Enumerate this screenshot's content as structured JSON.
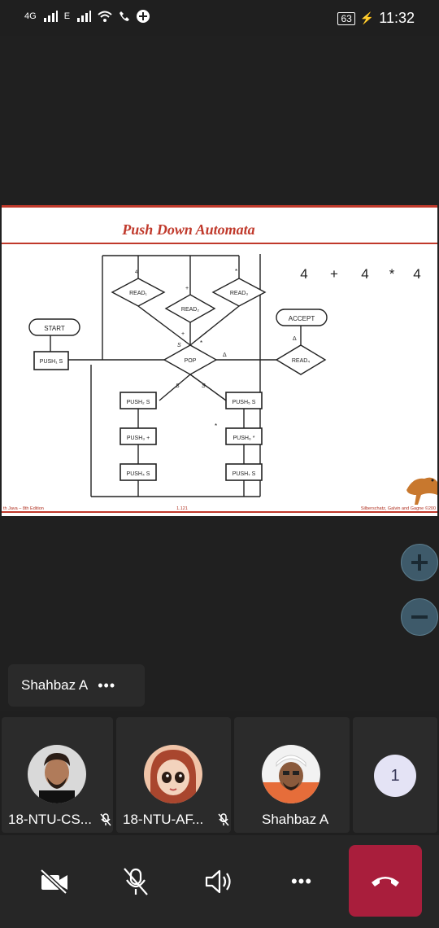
{
  "status_bar": {
    "network_1": "4G",
    "network_2": "E",
    "battery": "63",
    "time": "11:32"
  },
  "slide": {
    "title": "Push Down Automata",
    "expression": [
      "4",
      "+",
      "4",
      "*",
      "4"
    ],
    "nodes": {
      "start": "START",
      "push1": "PUSH₁ S",
      "pop": "POP",
      "read1": "READ₁",
      "read2": "READ₂",
      "read3": "READ₃",
      "read4": "READ₄",
      "accept": "ACCEPT",
      "push2": "PUSH₂ S",
      "push3": "PUSH₃ +",
      "push4": "PUSH₄ S",
      "push5": "PUSH₅ S",
      "push6": "PUSH₆ *",
      "push7": "PUSH₇ S"
    },
    "edge_labels": {
      "four": "4",
      "plus": "+",
      "star": "*",
      "delta": "Δ",
      "s": "S"
    },
    "footer_left": "th Java – 8th Edition",
    "footer_center": "1.121",
    "footer_right": "Silberschatz, Galvin and Gagne ©200"
  },
  "speaker_chip": {
    "name": "Shahbaz A",
    "more": "•••"
  },
  "participants": [
    {
      "name": "18-NTU-CS...",
      "muted": true
    },
    {
      "name": "18-NTU-AF...",
      "muted": true
    },
    {
      "name": "Shahbaz A",
      "muted": false
    }
  ],
  "overflow_count": "1",
  "controls": {
    "more": "•••"
  },
  "colors": {
    "title_red": "#c0392b",
    "hangup": "#a91e3c",
    "zoom_button": "#3e5a6a",
    "badge": "#e4e3f5"
  }
}
